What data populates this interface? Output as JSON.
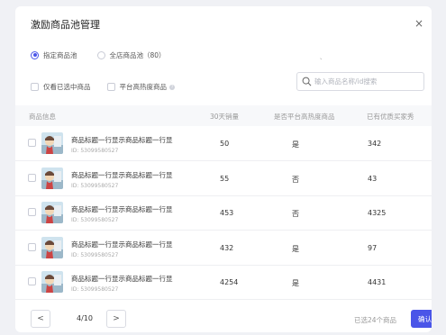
{
  "dialog": {
    "title": "激励商品池管理",
    "close_label": "×"
  },
  "scope": {
    "options": [
      {
        "label": "指定商品池",
        "checked": true
      },
      {
        "label": "全店商品池（80）",
        "checked": false
      }
    ],
    "tick": "、"
  },
  "filters": {
    "only_selected": "仅看已选中商品",
    "hot_products": "平台高热度商品",
    "help": "?"
  },
  "search": {
    "placeholder": "输入商品名称/id搜索",
    "value": ""
  },
  "table": {
    "headers": [
      "商品信息",
      "30天销量",
      "是否平台高热度商品",
      "已有优质买家秀"
    ],
    "rows": [
      {
        "name": "商品标题一行显示商品标题一行显",
        "id": "ID: 53099580527",
        "sales": "50",
        "hot": "是",
        "reviews": "342"
      },
      {
        "name": "商品标题一行显示商品标题一行显",
        "id": "ID: 53099580527",
        "sales": "55",
        "hot": "否",
        "reviews": "43"
      },
      {
        "name": "商品标题一行显示商品标题一行显",
        "id": "ID: 53099580527",
        "sales": "453",
        "hot": "否",
        "reviews": "4325"
      },
      {
        "name": "商品标题一行显示商品标题一行显",
        "id": "ID: 53099580527",
        "sales": "432",
        "hot": "是",
        "reviews": "97"
      },
      {
        "name": "商品标题一行显示商品标题一行显",
        "id": "ID: 53099580527",
        "sales": "4254",
        "hot": "是",
        "reviews": "4431"
      }
    ]
  },
  "pager": {
    "prev": "<",
    "next": ">",
    "info": "4/10",
    "selected_text": "已选24个商品",
    "confirm": "确认"
  },
  "colors": {
    "accent": "#4a55e8"
  }
}
